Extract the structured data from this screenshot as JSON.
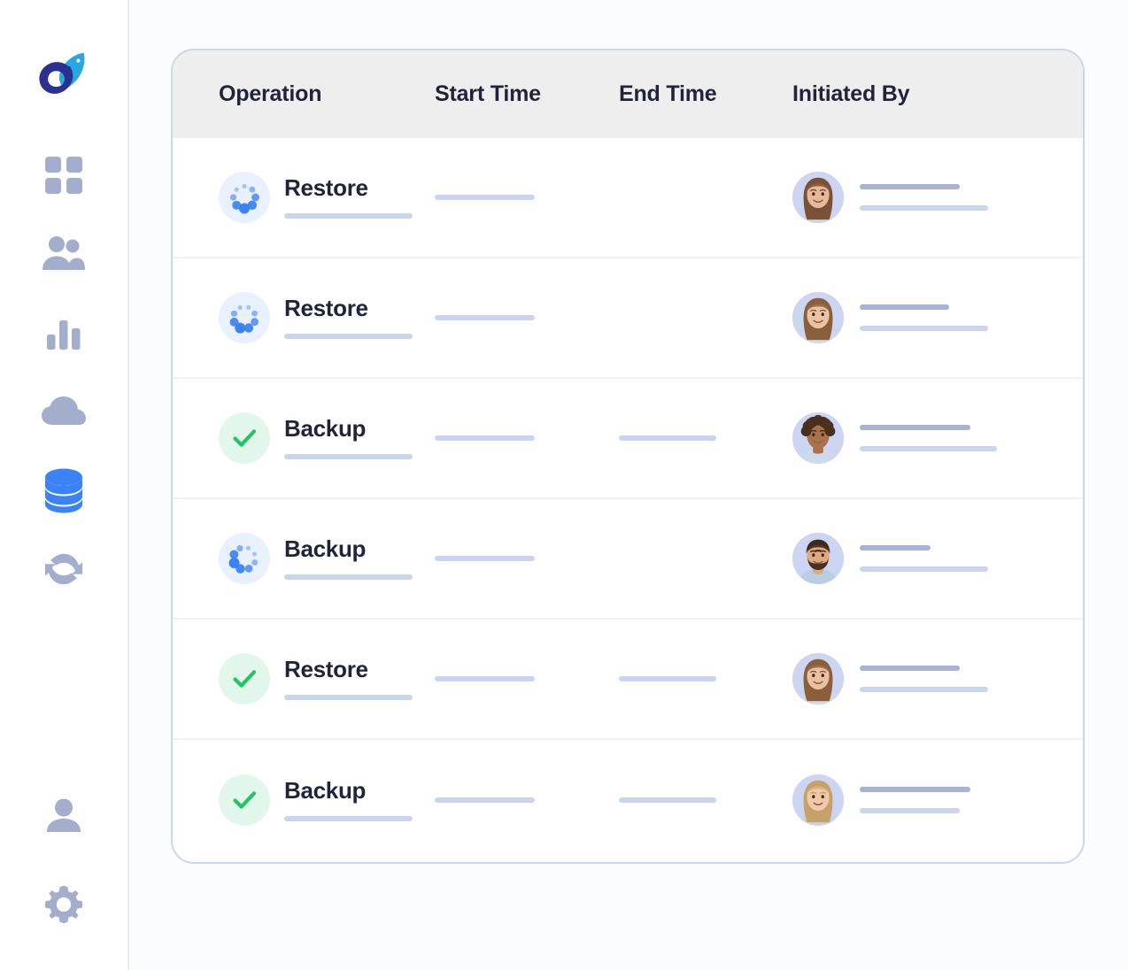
{
  "app": {
    "logo_name": "rocket-logo",
    "background": "#fbfcfe",
    "accent": "#3b82f6",
    "muted_icon_color": "#a3aecd",
    "success_color": "#22c55e"
  },
  "sidebar": {
    "top_items": [
      {
        "icon": "grid-dashboard-icon",
        "label": "Dashboard",
        "active": false
      },
      {
        "icon": "people-icon",
        "label": "Users",
        "active": false
      },
      {
        "icon": "bar-chart-icon",
        "label": "Analytics",
        "active": false
      },
      {
        "icon": "cloud-icon",
        "label": "Cloud",
        "active": false
      },
      {
        "icon": "database-icon",
        "label": "Database",
        "active": true
      },
      {
        "icon": "refresh-sync-icon",
        "label": "Sync",
        "active": false
      }
    ],
    "bottom_items": [
      {
        "icon": "user-profile-icon",
        "label": "Profile",
        "active": false
      },
      {
        "icon": "gear-settings-icon",
        "label": "Settings",
        "active": false
      }
    ]
  },
  "table": {
    "columns": [
      {
        "key": "operation",
        "label": "Operation"
      },
      {
        "key": "start_time",
        "label": "Start Time"
      },
      {
        "key": "end_time",
        "label": "End Time"
      },
      {
        "key": "initiated_by",
        "label": "Initiated By"
      }
    ],
    "rows": [
      {
        "operation": "Restore",
        "status": "running",
        "status_icon": "spinner-icon",
        "start_time_placeholder_width": 113,
        "end_time_placeholder_width": 0,
        "avatar": "avatar-woman-brown-hair",
        "name_placeholder_width": 113,
        "detail_placeholder_width": 145
      },
      {
        "operation": "Restore",
        "status": "running",
        "status_icon": "spinner-icon",
        "start_time_placeholder_width": 113,
        "end_time_placeholder_width": 0,
        "avatar": "avatar-woman-smiling",
        "name_placeholder_width": 101,
        "detail_placeholder_width": 145
      },
      {
        "operation": "Backup",
        "status": "completed",
        "status_icon": "check-circle-icon",
        "start_time_placeholder_width": 113,
        "end_time_placeholder_width": 110,
        "avatar": "avatar-man-curly-hair",
        "name_placeholder_width": 125,
        "detail_placeholder_width": 155
      },
      {
        "operation": "Backup",
        "status": "running",
        "status_icon": "spinner-icon",
        "start_time_placeholder_width": 113,
        "end_time_placeholder_width": 0,
        "avatar": "avatar-man-beard",
        "name_placeholder_width": 80,
        "detail_placeholder_width": 145
      },
      {
        "operation": "Restore",
        "status": "completed",
        "status_icon": "check-circle-icon",
        "start_time_placeholder_width": 113,
        "end_time_placeholder_width": 110,
        "avatar": "avatar-woman-long-hair",
        "name_placeholder_width": 113,
        "detail_placeholder_width": 145
      },
      {
        "operation": "Backup",
        "status": "completed",
        "status_icon": "check-circle-icon",
        "start_time_placeholder_width": 113,
        "end_time_placeholder_width": 110,
        "avatar": "avatar-woman-blonde",
        "name_placeholder_width": 125,
        "detail_placeholder_width": 113
      }
    ]
  }
}
